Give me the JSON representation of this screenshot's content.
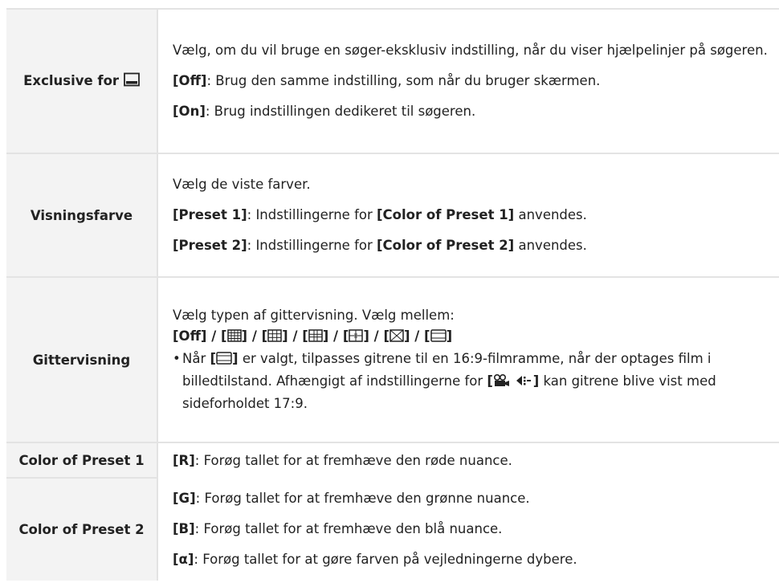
{
  "rows": {
    "exclusive": {
      "label": "Exclusive for",
      "label_icon": "viewfinder-icon",
      "desc_line1": "Vælg, om du vil bruge en søger-eksklusiv indstilling, når du viser hjælpelinjer på søgeren.",
      "off_key": "[Off]",
      "off_text": ": Brug den samme indstilling, som når du bruger skærmen.",
      "on_key": "[On]",
      "on_text": ": Brug indstillingen dedikeret til søgeren."
    },
    "visningsfarve": {
      "label": "Visningsfarve",
      "desc_line1": "Vælg de viste farver.",
      "p1_key": "[Preset 1]",
      "p1_text_a": ": Indstillingerne for ",
      "p1_ref": "[Color of Preset 1]",
      "p1_text_b": " anvendes.",
      "p2_key": "[Preset 2]",
      "p2_text_a": ": Indstillingerne for ",
      "p2_ref": "[Color of Preset 2]",
      "p2_text_b": " anvendes."
    },
    "gittervisning": {
      "label": "Gittervisning",
      "desc_line1": "Vælg typen af gittervisning. Vælg mellem:",
      "opt_off": "[Off]",
      "sep": " / ",
      "bullet_a": "Når ",
      "bullet_b": " er valgt, tilpasses gitrene til en 16:9-filmramme, når der optages film i billedtilstand. Afhængigt af indstillingerne for ",
      "bullet_c": " kan gitrene blive vist med sideforholdet 17:9.",
      "option_icons": [
        "grid-4x4-icon",
        "grid-3x3-icon",
        "grid-golden-icon",
        "grid-center-cross-icon",
        "grid-diagonal-icon",
        "grid-16x9-icon"
      ],
      "movie_icons": [
        "movie-camera-icon",
        "aspect-ratio-icon"
      ]
    },
    "color_preset": {
      "label1": "Color of Preset 1",
      "label2": "Color of Preset 2",
      "r_key": "[R]",
      "r_text": ": Forøg tallet for at fremhæve den røde nuance.",
      "g_key": "[G]",
      "g_text": ": Forøg tallet for at fremhæve den grønne nuance.",
      "b_key": "[B]",
      "b_text": ": Forøg tallet for at fremhæve den blå nuance.",
      "a_key": "[α]",
      "a_text": ": Forøg tallet for at gøre farven på vejledningerne dybere."
    }
  }
}
